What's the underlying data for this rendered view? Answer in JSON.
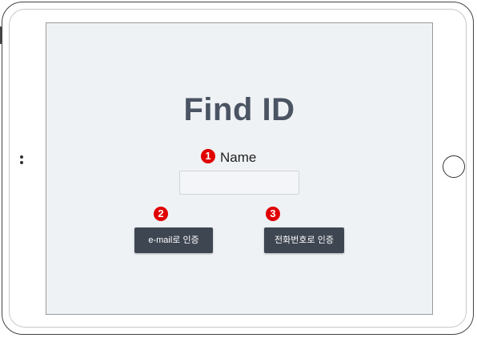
{
  "screen": {
    "title": "Find ID",
    "name_label": "Name",
    "name_input": {
      "value": "",
      "placeholder": ""
    },
    "email_button_label": "e-mail로 인증",
    "phone_button_label": "전화번호로 인증"
  },
  "markers": [
    {
      "label": "1"
    },
    {
      "label": "2"
    },
    {
      "label": "3"
    }
  ],
  "colors": {
    "screen_background": "#eff2f5",
    "button_background": "#3e4652",
    "title_color": "#4a5462",
    "marker_color": "#e00000"
  },
  "icons": {
    "home_button": "home-button-icon",
    "camera": "camera-icon"
  }
}
